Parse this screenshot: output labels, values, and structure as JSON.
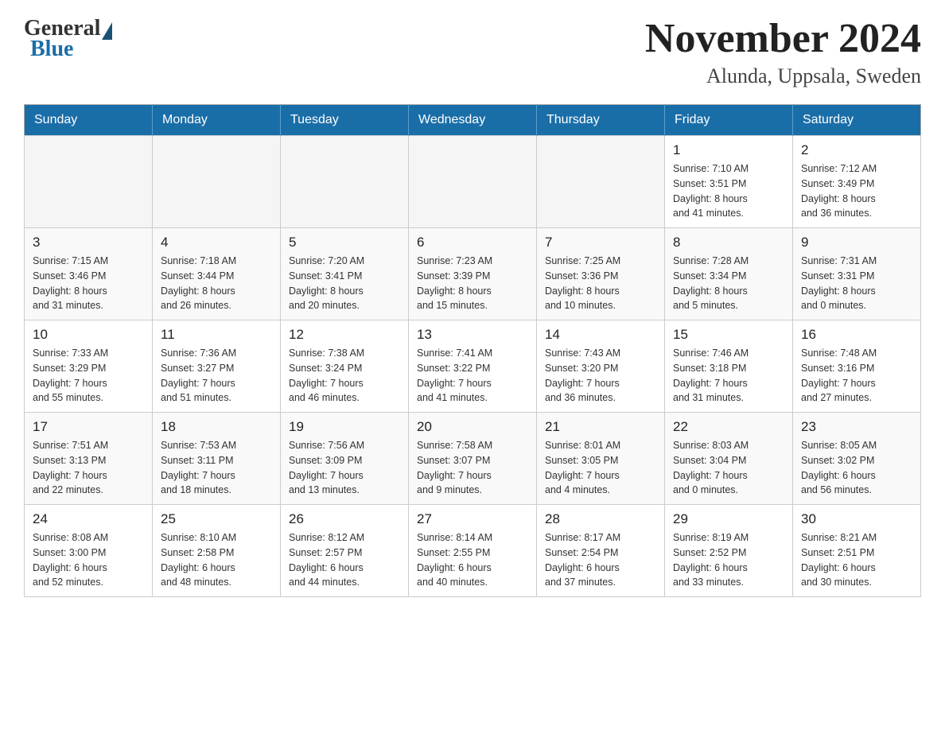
{
  "header": {
    "logo_general": "General",
    "logo_blue": "Blue",
    "month_title": "November 2024",
    "location": "Alunda, Uppsala, Sweden"
  },
  "weekdays": [
    "Sunday",
    "Monday",
    "Tuesday",
    "Wednesday",
    "Thursday",
    "Friday",
    "Saturday"
  ],
  "weeks": [
    [
      {
        "day": "",
        "info": ""
      },
      {
        "day": "",
        "info": ""
      },
      {
        "day": "",
        "info": ""
      },
      {
        "day": "",
        "info": ""
      },
      {
        "day": "",
        "info": ""
      },
      {
        "day": "1",
        "info": "Sunrise: 7:10 AM\nSunset: 3:51 PM\nDaylight: 8 hours\nand 41 minutes."
      },
      {
        "day": "2",
        "info": "Sunrise: 7:12 AM\nSunset: 3:49 PM\nDaylight: 8 hours\nand 36 minutes."
      }
    ],
    [
      {
        "day": "3",
        "info": "Sunrise: 7:15 AM\nSunset: 3:46 PM\nDaylight: 8 hours\nand 31 minutes."
      },
      {
        "day": "4",
        "info": "Sunrise: 7:18 AM\nSunset: 3:44 PM\nDaylight: 8 hours\nand 26 minutes."
      },
      {
        "day": "5",
        "info": "Sunrise: 7:20 AM\nSunset: 3:41 PM\nDaylight: 8 hours\nand 20 minutes."
      },
      {
        "day": "6",
        "info": "Sunrise: 7:23 AM\nSunset: 3:39 PM\nDaylight: 8 hours\nand 15 minutes."
      },
      {
        "day": "7",
        "info": "Sunrise: 7:25 AM\nSunset: 3:36 PM\nDaylight: 8 hours\nand 10 minutes."
      },
      {
        "day": "8",
        "info": "Sunrise: 7:28 AM\nSunset: 3:34 PM\nDaylight: 8 hours\nand 5 minutes."
      },
      {
        "day": "9",
        "info": "Sunrise: 7:31 AM\nSunset: 3:31 PM\nDaylight: 8 hours\nand 0 minutes."
      }
    ],
    [
      {
        "day": "10",
        "info": "Sunrise: 7:33 AM\nSunset: 3:29 PM\nDaylight: 7 hours\nand 55 minutes."
      },
      {
        "day": "11",
        "info": "Sunrise: 7:36 AM\nSunset: 3:27 PM\nDaylight: 7 hours\nand 51 minutes."
      },
      {
        "day": "12",
        "info": "Sunrise: 7:38 AM\nSunset: 3:24 PM\nDaylight: 7 hours\nand 46 minutes."
      },
      {
        "day": "13",
        "info": "Sunrise: 7:41 AM\nSunset: 3:22 PM\nDaylight: 7 hours\nand 41 minutes."
      },
      {
        "day": "14",
        "info": "Sunrise: 7:43 AM\nSunset: 3:20 PM\nDaylight: 7 hours\nand 36 minutes."
      },
      {
        "day": "15",
        "info": "Sunrise: 7:46 AM\nSunset: 3:18 PM\nDaylight: 7 hours\nand 31 minutes."
      },
      {
        "day": "16",
        "info": "Sunrise: 7:48 AM\nSunset: 3:16 PM\nDaylight: 7 hours\nand 27 minutes."
      }
    ],
    [
      {
        "day": "17",
        "info": "Sunrise: 7:51 AM\nSunset: 3:13 PM\nDaylight: 7 hours\nand 22 minutes."
      },
      {
        "day": "18",
        "info": "Sunrise: 7:53 AM\nSunset: 3:11 PM\nDaylight: 7 hours\nand 18 minutes."
      },
      {
        "day": "19",
        "info": "Sunrise: 7:56 AM\nSunset: 3:09 PM\nDaylight: 7 hours\nand 13 minutes."
      },
      {
        "day": "20",
        "info": "Sunrise: 7:58 AM\nSunset: 3:07 PM\nDaylight: 7 hours\nand 9 minutes."
      },
      {
        "day": "21",
        "info": "Sunrise: 8:01 AM\nSunset: 3:05 PM\nDaylight: 7 hours\nand 4 minutes."
      },
      {
        "day": "22",
        "info": "Sunrise: 8:03 AM\nSunset: 3:04 PM\nDaylight: 7 hours\nand 0 minutes."
      },
      {
        "day": "23",
        "info": "Sunrise: 8:05 AM\nSunset: 3:02 PM\nDaylight: 6 hours\nand 56 minutes."
      }
    ],
    [
      {
        "day": "24",
        "info": "Sunrise: 8:08 AM\nSunset: 3:00 PM\nDaylight: 6 hours\nand 52 minutes."
      },
      {
        "day": "25",
        "info": "Sunrise: 8:10 AM\nSunset: 2:58 PM\nDaylight: 6 hours\nand 48 minutes."
      },
      {
        "day": "26",
        "info": "Sunrise: 8:12 AM\nSunset: 2:57 PM\nDaylight: 6 hours\nand 44 minutes."
      },
      {
        "day": "27",
        "info": "Sunrise: 8:14 AM\nSunset: 2:55 PM\nDaylight: 6 hours\nand 40 minutes."
      },
      {
        "day": "28",
        "info": "Sunrise: 8:17 AM\nSunset: 2:54 PM\nDaylight: 6 hours\nand 37 minutes."
      },
      {
        "day": "29",
        "info": "Sunrise: 8:19 AM\nSunset: 2:52 PM\nDaylight: 6 hours\nand 33 minutes."
      },
      {
        "day": "30",
        "info": "Sunrise: 8:21 AM\nSunset: 2:51 PM\nDaylight: 6 hours\nand 30 minutes."
      }
    ]
  ]
}
